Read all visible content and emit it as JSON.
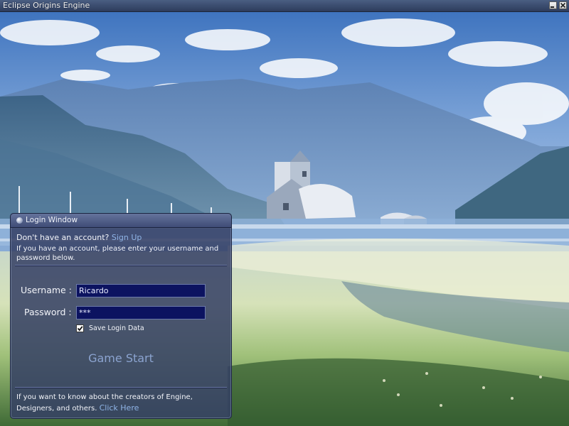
{
  "window": {
    "title": "Eclipse Origins Engine"
  },
  "login_window": {
    "title": "Login Window",
    "signup_prompt": "Don't have an account?",
    "signup_link": "Sign Up",
    "instructions": "If you have an account, please enter your username and password below.",
    "username_label": "Username :",
    "username_value": "Ricardo",
    "password_label": "Password :",
    "password_value": "***",
    "save_login_label": "Save Login Data",
    "save_login_checked": true,
    "game_start_label": "Game Start",
    "credits_text": "If you want to know about the creators of Engine, Designers, and others.",
    "credits_link": "Click Here"
  },
  "colors": {
    "input_bg": "#0c1360",
    "link": "#8fb4e6",
    "panel_bg": "#343f64"
  }
}
